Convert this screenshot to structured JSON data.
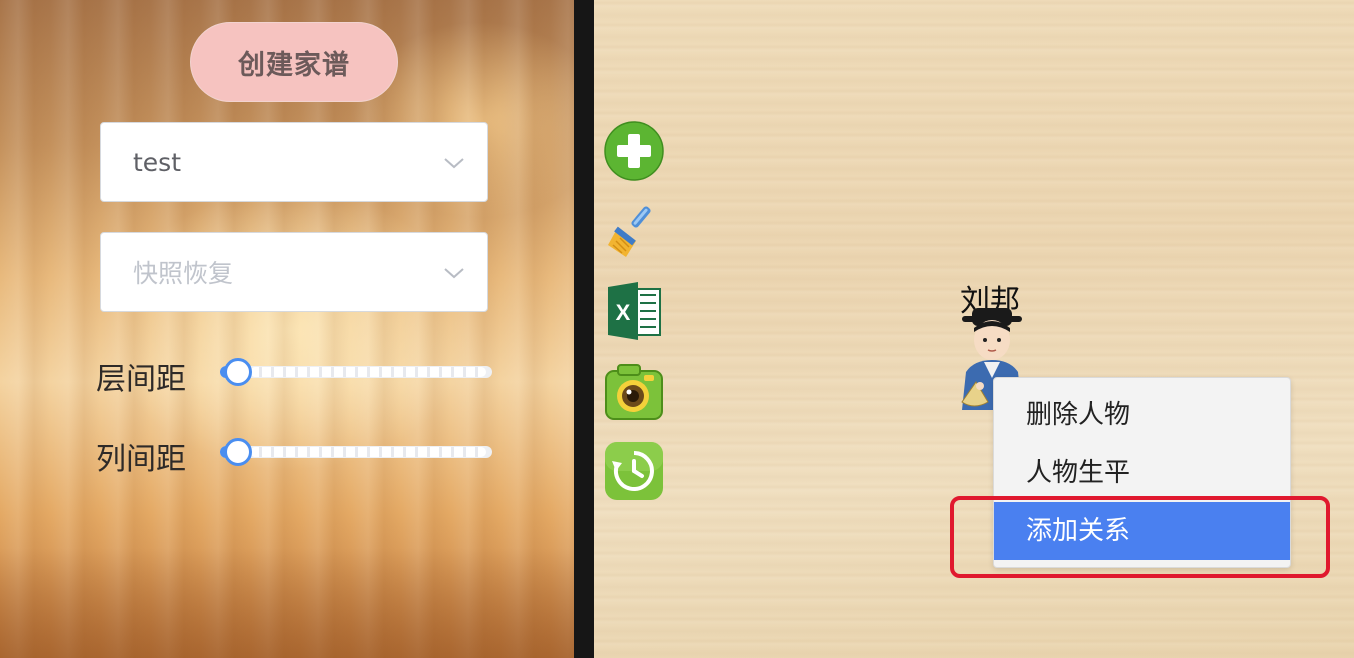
{
  "left_panel": {
    "create_button": "创建家谱",
    "family_select": {
      "value": "test"
    },
    "snapshot_select": {
      "placeholder": "快照恢复"
    },
    "sliders": [
      {
        "label": "层间距",
        "value_fraction": 0.0
      },
      {
        "label": "列间距",
        "value_fraction": 0.0
      }
    ]
  },
  "toolbar": {
    "icons": [
      "add-icon",
      "clean-broom-icon",
      "excel-icon",
      "camera-icon",
      "history-icon"
    ]
  },
  "canvas": {
    "person": {
      "name": "刘邦"
    }
  },
  "context_menu": {
    "items": [
      "删除人物",
      "人物生平",
      "添加关系"
    ],
    "active_index": 2
  },
  "colors": {
    "accent": "#4a80f0",
    "create_button": "#f6c3c0",
    "highlight": "#e0182e"
  }
}
